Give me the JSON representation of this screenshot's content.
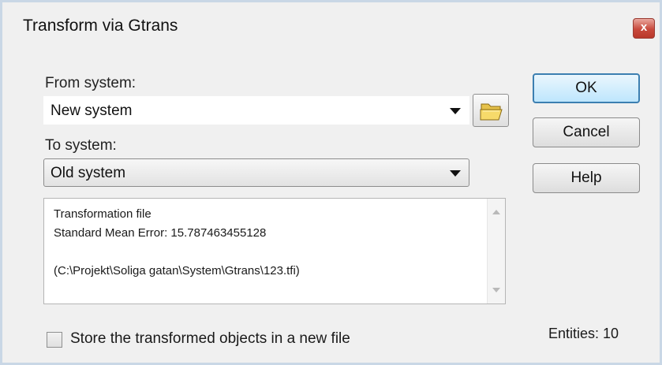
{
  "window": {
    "title": "Transform via Gtrans",
    "close_label": "x"
  },
  "from_system": {
    "label": "From system:",
    "value": "New system"
  },
  "to_system": {
    "label": "To system:",
    "value": "Old system"
  },
  "info": {
    "line1": "Transformation file",
    "line2": "Standard Mean Error: 15.787463455128",
    "line3": "",
    "line4": "(C:\\Projekt\\Soliga gatan\\System\\Gtrans\\123.tfi)"
  },
  "store_option": {
    "label": "Store the transformed objects  in a new file",
    "checked": false
  },
  "buttons": {
    "ok": "OK",
    "cancel": "Cancel",
    "help": "Help"
  },
  "status": {
    "entities": "Entities: 10"
  },
  "icons": {
    "folder": "folder-open-icon",
    "close": "close-icon"
  },
  "colors": {
    "close_button": "#c8493c",
    "default_button_border": "#3c7fb1"
  }
}
